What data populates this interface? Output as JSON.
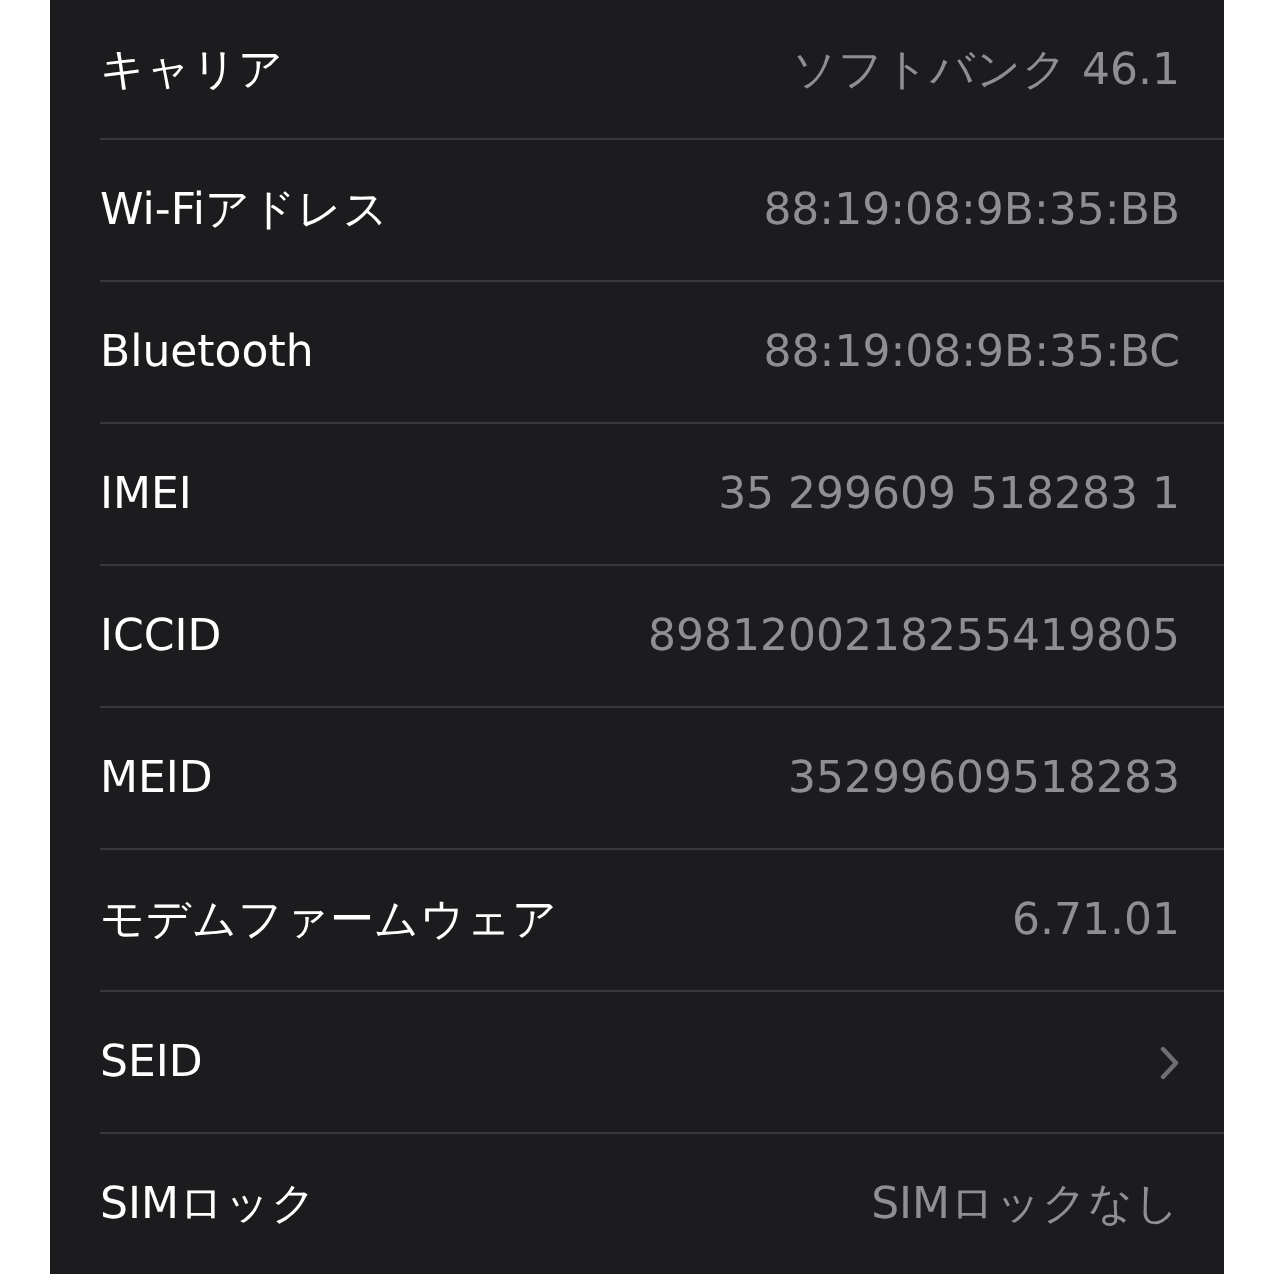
{
  "rows": [
    {
      "kind": "value",
      "label": "キャリア",
      "value": "ソフトバンク 46.1"
    },
    {
      "kind": "value",
      "label": "Wi-Fiアドレス",
      "value": "88:19:08:9B:35:BB"
    },
    {
      "kind": "value",
      "label": "Bluetooth",
      "value": "88:19:08:9B:35:BC"
    },
    {
      "kind": "value",
      "label": "IMEI",
      "value": "35 299609 518283 1"
    },
    {
      "kind": "value",
      "label": "ICCID",
      "value": "8981200218255419805"
    },
    {
      "kind": "value",
      "label": "MEID",
      "value": "35299609518283"
    },
    {
      "kind": "value",
      "label": "モデムファームウェア",
      "value": "6.71.01"
    },
    {
      "kind": "link",
      "label": "SEID"
    },
    {
      "kind": "value",
      "label": "SIMロック",
      "value": "SIMロックなし"
    }
  ]
}
